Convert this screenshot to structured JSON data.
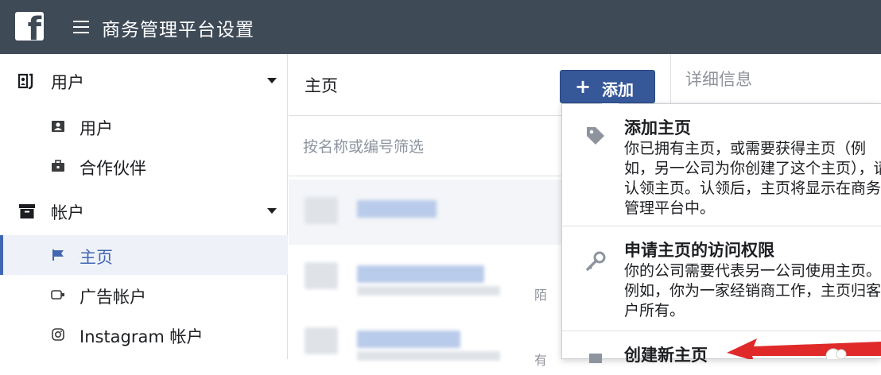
{
  "app": {
    "logo_letter": "f",
    "title": "商务管理平台设置"
  },
  "sidebar": {
    "sections": [
      {
        "label": "用户",
        "icon": "users-icon",
        "items": [
          {
            "label": "用户",
            "icon": "person-badge-icon"
          },
          {
            "label": "合作伙伴",
            "icon": "briefcase-icon"
          }
        ]
      },
      {
        "label": "帐户",
        "icon": "archive-box-icon",
        "items": [
          {
            "label": "主页",
            "icon": "flag-icon",
            "active": true
          },
          {
            "label": "广告帐户",
            "icon": "ad-account-icon"
          },
          {
            "label": "Instagram 帐户",
            "icon": "instagram-icon"
          }
        ]
      }
    ]
  },
  "pages_panel": {
    "title": "主页",
    "add_button": {
      "icon": "+",
      "label": "添加"
    },
    "filter_placeholder": "按名称或编号筛选",
    "rows": [
      {
        "tail": ""
      },
      {
        "tail": "陌"
      },
      {
        "tail": "有"
      }
    ]
  },
  "details_panel": {
    "title": "详细信息"
  },
  "add_menu": {
    "items": [
      {
        "icon": "tag-icon",
        "title": "添加主页",
        "description": "你已拥有主页，或需要获得主页（例如，另一公司为你创建了这个主页），请认领主页。认领后，主页将显示在商务管理平台中。"
      },
      {
        "icon": "key-icon",
        "title": "申请主页的访问权限",
        "description": "你的公司需要代表另一公司使用主页。例如，你为一家经销商工作，主页归客户所有。"
      },
      {
        "icon": "new-page-icon",
        "title": "创建新主页",
        "description": ""
      }
    ]
  },
  "colors": {
    "topbar": "#3f4a57",
    "accent": "#4267b2",
    "button": "#365899",
    "annotation_arrow": "#e02a2a"
  }
}
